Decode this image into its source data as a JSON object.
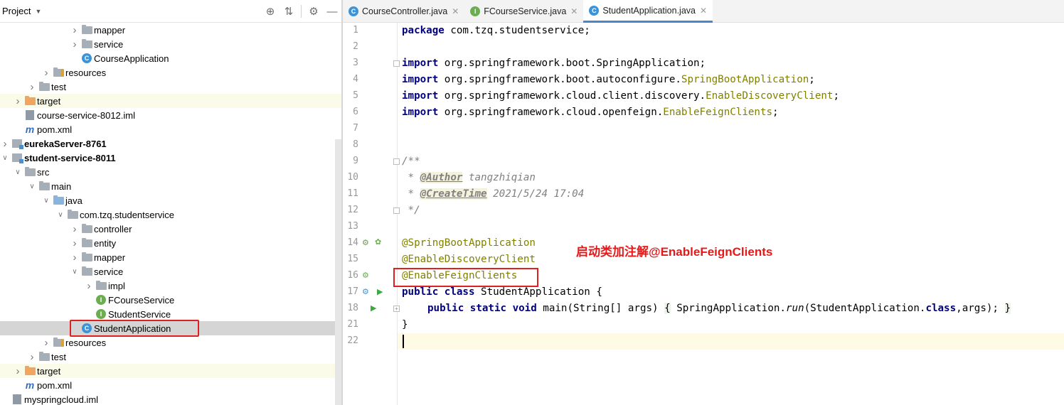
{
  "project_panel": {
    "title": "Project",
    "tools": [
      "target-icon",
      "collapse-icon",
      "gear-icon",
      "minimize-icon"
    ],
    "tree": [
      {
        "label": "mapper",
        "icon": "folder",
        "indent": 5,
        "arrow": "collapsed"
      },
      {
        "label": "service",
        "icon": "folder",
        "indent": 5,
        "arrow": "collapsed"
      },
      {
        "label": "CourseApplication",
        "icon": "spring-class",
        "indent": 5,
        "arrow": "none"
      },
      {
        "label": "resources",
        "icon": "resources-folder",
        "indent": 3,
        "arrow": "collapsed"
      },
      {
        "label": "test",
        "icon": "folder",
        "indent": 2,
        "arrow": "collapsed"
      },
      {
        "label": "target",
        "icon": "orange-folder",
        "indent": 1,
        "arrow": "collapsed",
        "highlight": true
      },
      {
        "label": "course-service-8012.iml",
        "icon": "iml-file",
        "indent": 1,
        "arrow": "none"
      },
      {
        "label": "pom.xml",
        "icon": "maven",
        "indent": 1,
        "arrow": "none"
      },
      {
        "label": "eurekaServer-8761",
        "icon": "module",
        "indent": 0,
        "arrow": "collapsed",
        "bold": true
      },
      {
        "label": "student-service-8011",
        "icon": "module",
        "indent": 0,
        "arrow": "expanded",
        "bold": true
      },
      {
        "label": "src",
        "icon": "folder",
        "indent": 1,
        "arrow": "expanded"
      },
      {
        "label": "main",
        "icon": "folder",
        "indent": 2,
        "arrow": "expanded"
      },
      {
        "label": "java",
        "icon": "blue-folder",
        "indent": 3,
        "arrow": "expanded"
      },
      {
        "label": "com.tzq.studentservice",
        "icon": "folder",
        "indent": 4,
        "arrow": "expanded"
      },
      {
        "label": "controller",
        "icon": "folder",
        "indent": 5,
        "arrow": "collapsed"
      },
      {
        "label": "entity",
        "icon": "folder",
        "indent": 5,
        "arrow": "collapsed"
      },
      {
        "label": "mapper",
        "icon": "folder",
        "indent": 5,
        "arrow": "collapsed"
      },
      {
        "label": "service",
        "icon": "folder",
        "indent": 5,
        "arrow": "expanded"
      },
      {
        "label": "impl",
        "icon": "folder",
        "indent": 6,
        "arrow": "collapsed"
      },
      {
        "label": "FCourseService",
        "icon": "interface",
        "indent": 6,
        "arrow": "none"
      },
      {
        "label": "StudentService",
        "icon": "interface",
        "indent": 6,
        "arrow": "none"
      },
      {
        "label": "StudentApplication",
        "icon": "spring-class",
        "indent": 5,
        "arrow": "none",
        "selected": true
      },
      {
        "label": "resources",
        "icon": "resources-folder",
        "indent": 3,
        "arrow": "collapsed"
      },
      {
        "label": "test",
        "icon": "folder",
        "indent": 2,
        "arrow": "collapsed"
      },
      {
        "label": "target",
        "icon": "orange-folder",
        "indent": 1,
        "arrow": "collapsed",
        "highlight": true
      },
      {
        "label": "pom.xml",
        "icon": "maven",
        "indent": 1,
        "arrow": "none"
      },
      {
        "label": "myspringcloud.iml",
        "icon": "iml-file",
        "indent": 0,
        "arrow": "none"
      }
    ]
  },
  "tabs": [
    {
      "label": "CourseController.java",
      "icon": "C",
      "active": false
    },
    {
      "label": "FCourseService.java",
      "icon": "I",
      "active": false
    },
    {
      "label": "StudentApplication.java",
      "icon": "C",
      "active": true
    }
  ],
  "editor": {
    "line_numbers": [
      "1",
      "2",
      "3",
      "4",
      "5",
      "6",
      "7",
      "8",
      "9",
      "10",
      "11",
      "12",
      "13",
      "14",
      "15",
      "16",
      "17",
      "18",
      "21",
      "22"
    ],
    "code": {
      "l1_kw": "package",
      "l1_rest": " com.tzq.studentservice;",
      "import_kw": "import",
      "l3_pkg": " org.springframework.boot.SpringApplication;",
      "l4_pkg": " org.springframework.boot.autoconfigure.",
      "l4_cls": "SpringBootApplication",
      "l4_end": ";",
      "l5_pkg": " org.springframework.cloud.client.discovery.",
      "l5_cls": "EnableDiscoveryClient",
      "l5_end": ";",
      "l6_pkg": " org.springframework.cloud.openfeign.",
      "l6_cls": "EnableFeignClients",
      "l6_end": ";",
      "l9": "/**",
      "l10_star": " * ",
      "l10_tag": "@Author",
      "l10_val": " tangzhiqian",
      "l11_star": " * ",
      "l11_tag": "@CreateTime",
      "l11_val": " 2021/5/24 17:04",
      "l12": " */",
      "l14": "@SpringBootApplication",
      "l15": "@EnableDiscoveryClient",
      "l16": "@EnableFeignClients",
      "l17_kw": "public class",
      "l17_rest": " StudentApplication {",
      "l18_kw": "public static void",
      "l18_a": " main(String[] args) ",
      "l18_b": "{",
      "l18_c": " SpringApplication.",
      "l18_run": "run",
      "l18_d": "(StudentApplication.",
      "l18_class": "class",
      "l18_e": ",args); ",
      "l18_f": "}",
      "l21": "}"
    },
    "annotation_note": "启动类加注解@EnableFeignClients"
  }
}
